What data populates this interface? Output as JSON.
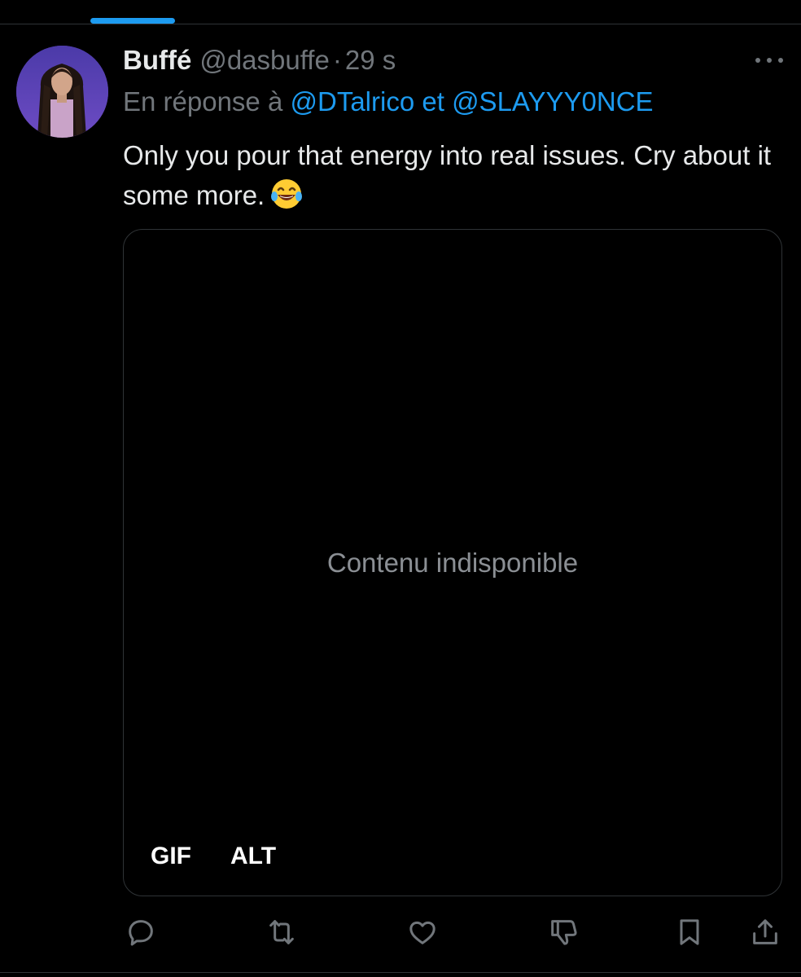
{
  "tweet": {
    "display_name": "Buffé",
    "handle": "@dasbuffe",
    "separator": "·",
    "time": "29 s",
    "reply_prefix": "En réponse à",
    "reply_user_1": "@DTalrico",
    "reply_conjunction": "et",
    "reply_user_2": "@SLAYYY0NCE",
    "text": "Only you pour that energy into real issues. Cry about it some more.",
    "text_emoji": "face-with-tears-of-joy",
    "media": {
      "status": "Contenu indisponible",
      "badge_gif": "GIF",
      "badge_alt": "ALT"
    }
  },
  "actions": [
    "reply-icon",
    "retweet-icon",
    "like-icon",
    "dislike-icon",
    "bookmark-icon",
    "share-icon"
  ],
  "colors": {
    "background": "#000000",
    "accent": "#1d9bf0",
    "text_primary": "#e7e9ea",
    "text_secondary": "#71767b",
    "border": "#2f3336"
  }
}
